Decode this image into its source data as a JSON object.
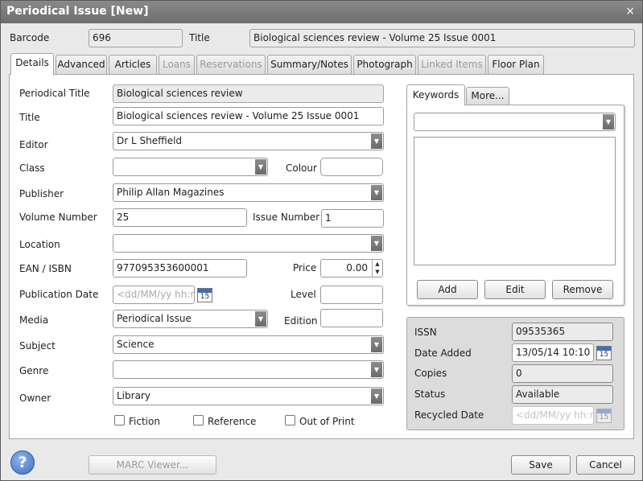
{
  "window": {
    "title": "Periodical Issue [New]",
    "close_glyph": "×"
  },
  "header": {
    "barcode_label": "Barcode",
    "barcode_value": "696",
    "title_label": "Title",
    "title_value": "Biological sciences review - Volume 25 Issue 0001"
  },
  "tabs": [
    {
      "label": "Details",
      "active": true,
      "enabled": true
    },
    {
      "label": "Advanced",
      "enabled": true
    },
    {
      "label": "Articles",
      "enabled": true
    },
    {
      "label": "Loans",
      "enabled": false
    },
    {
      "label": "Reservations",
      "enabled": false
    },
    {
      "label": "Summary/Notes",
      "enabled": true
    },
    {
      "label": "Photograph",
      "enabled": true
    },
    {
      "label": "Linked Items",
      "enabled": false
    },
    {
      "label": "Floor Plan",
      "enabled": true
    }
  ],
  "details": {
    "periodical_title": {
      "label": "Periodical Title",
      "value": "Biological sciences review"
    },
    "title": {
      "label": "Title",
      "value": "Biological sciences review - Volume 25 Issue 0001"
    },
    "editor": {
      "label": "Editor",
      "value": "Dr L Sheffield"
    },
    "class": {
      "label": "Class",
      "value": ""
    },
    "colour": {
      "label": "Colour",
      "value": ""
    },
    "publisher": {
      "label": "Publisher",
      "value": "Philip Allan Magazines"
    },
    "volume_number": {
      "label": "Volume Number",
      "value": "25"
    },
    "issue_number": {
      "label": "Issue Number",
      "value": "1"
    },
    "location": {
      "label": "Location",
      "value": ""
    },
    "ean_isbn": {
      "label": "EAN / ISBN",
      "value": "977095353600001"
    },
    "price": {
      "label": "Price",
      "value": "0.00"
    },
    "publication_date": {
      "label": "Publication Date",
      "placeholder": "<dd/MM/yy hh:mm"
    },
    "level": {
      "label": "Level",
      "value": ""
    },
    "media": {
      "label": "Media",
      "value": "Periodical Issue"
    },
    "edition": {
      "label": "Edition",
      "value": ""
    },
    "subject": {
      "label": "Subject",
      "value": "Science"
    },
    "genre": {
      "label": "Genre",
      "value": ""
    },
    "owner": {
      "label": "Owner",
      "value": "Library"
    },
    "fiction": {
      "label": "Fiction",
      "checked": false
    },
    "reference": {
      "label": "Reference",
      "checked": false
    },
    "out_of_print": {
      "label": "Out of Print",
      "checked": false
    },
    "calendar_glyph": "15"
  },
  "keywords": {
    "tabs": [
      {
        "label": "Keywords",
        "active": true
      },
      {
        "label": "More..."
      }
    ],
    "add_label": "Add",
    "edit_label": "Edit",
    "remove_label": "Remove"
  },
  "info": {
    "issn": {
      "label": "ISSN",
      "value": "09535365"
    },
    "date_added": {
      "label": "Date Added",
      "value": "13/05/14 10:10"
    },
    "copies": {
      "label": "Copies",
      "value": "0"
    },
    "status": {
      "label": "Status",
      "value": "Available"
    },
    "recycled_date": {
      "label": "Recycled Date",
      "placeholder": "<dd/MM/yy hh:mm"
    }
  },
  "footer": {
    "help_glyph": "?",
    "marc_label": "MARC Viewer...",
    "save_label": "Save",
    "cancel_label": "Cancel"
  },
  "colors": {
    "titlebar": "#7a7a7a",
    "accent": "#3e6fc0"
  },
  "icons": {
    "dropdown": "chevron-down-icon",
    "calendar": "calendar-icon",
    "help": "help-icon",
    "close": "close-icon"
  }
}
